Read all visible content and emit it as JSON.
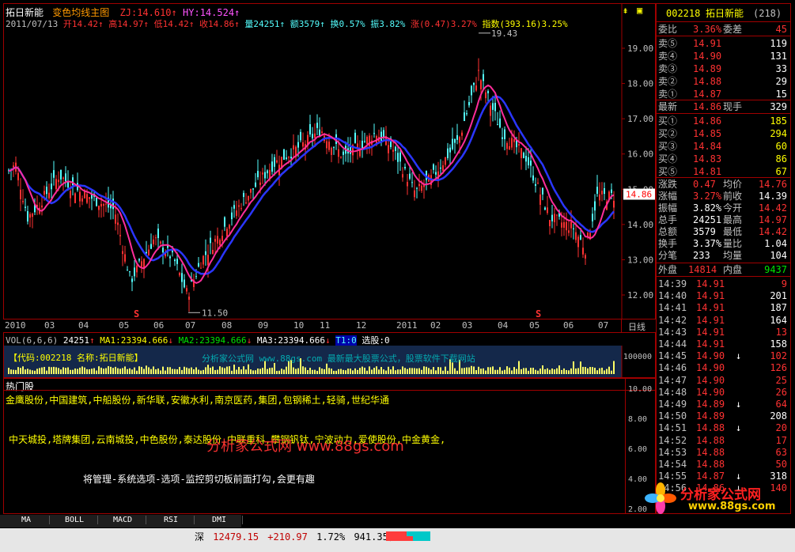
{
  "stock": {
    "code": "002218",
    "name": "拓日新能",
    "count": "(218)"
  },
  "chart_header": {
    "name": "拓日新能",
    "formula": "变色均线主图",
    "zj_label": "ZJ:",
    "zj_value": "14.610",
    "hy_label": "HY:",
    "hy_value": "14.524",
    "date": "2011/07/13",
    "open": "开14.42",
    "high": "高14.97",
    "low": "低14.42",
    "close": "收14.86",
    "vol": "量24251",
    "amt": "额3579",
    "turnover": "换0.57%",
    "amp": "振3.82%",
    "change": "涨(0.47)3.27%",
    "index": "指数(393.16)3.25%"
  },
  "y_axis": [
    "19.00",
    "18.00",
    "17.00",
    "16.00",
    "15.00",
    "14.00",
    "13.00",
    "12.00"
  ],
  "price_tag": "14.86",
  "annotations": {
    "high": "19.43",
    "low": "11.50"
  },
  "signals": [
    "S",
    "S"
  ],
  "x_axis": [
    "2010",
    "03",
    "04",
    "05",
    "06",
    "07",
    "08",
    "09",
    "10",
    "11",
    "12",
    "2011",
    "02",
    "03",
    "04",
    "05",
    "06",
    "07"
  ],
  "x_axis_right": "日线",
  "vol_header": {
    "label": "VOL(6,6,6)",
    "vol": "24251",
    "ma1": "MA1:23394.666",
    "ma2": "MA2:23394.666",
    "ma3": "MA3:23394.666",
    "t1": "T1:0",
    "xg": "选股:0"
  },
  "vol_info": "【代码:002218 名称:拓日新能】",
  "vol_watermark": "分析家公式网 www.88gs.com 最新最大股票公式，股票软件下载网站",
  "vol_axis": "100000",
  "hot": {
    "title": "热门股",
    "line1": "金鹰股份,中国建筑,中船股份,新华联,安徽水利,南京医药,集团,包钢稀土,轻骑,世纪华通",
    "line2": "中天城投,塔牌集团,云南城投,中色股份,泰达股份,中联重科,攀钢钒钛,宁波动力,爱使股份,中金黄金,",
    "watermark": "分析家公式网 www.88gs.com",
    "tip": "将管理-系统选项-选项-监控剪切板前面打勾,会更有趣"
  },
  "hot_axis": [
    "10.00",
    "8.00",
    "6.00",
    "4.00",
    "2.00"
  ],
  "quote": {
    "weibi_label": "委比",
    "weibi_val": "3.36%",
    "weicha_label": "委差",
    "weicha_val": "45",
    "sells": [
      {
        "label": "卖⑤",
        "price": "14.91",
        "vol": "119"
      },
      {
        "label": "卖④",
        "price": "14.90",
        "vol": "131"
      },
      {
        "label": "卖③",
        "price": "14.89",
        "vol": "33"
      },
      {
        "label": "卖②",
        "price": "14.88",
        "vol": "29"
      },
      {
        "label": "卖①",
        "price": "14.87",
        "vol": "15"
      }
    ],
    "last_label": "最新",
    "last": "14.86",
    "xianshou_label": "现手",
    "xianshou": "329",
    "buys": [
      {
        "label": "买①",
        "price": "14.86",
        "vol": "185"
      },
      {
        "label": "买②",
        "price": "14.85",
        "vol": "294"
      },
      {
        "label": "买③",
        "price": "14.84",
        "vol": "60"
      },
      {
        "label": "买④",
        "price": "14.83",
        "vol": "86"
      },
      {
        "label": "买⑤",
        "price": "14.81",
        "vol": "67"
      }
    ],
    "stats": [
      {
        "l1": "涨跌",
        "v1": "0.47",
        "c1": "red",
        "l2": "均价",
        "v2": "14.76",
        "c2": "red"
      },
      {
        "l1": "涨幅",
        "v1": "3.27%",
        "c1": "red",
        "l2": "前收",
        "v2": "14.39",
        "c2": "wht"
      },
      {
        "l1": "振幅",
        "v1": "3.82%",
        "c1": "wht",
        "l2": "今开",
        "v2": "14.42",
        "c2": "red"
      },
      {
        "l1": "总手",
        "v1": "24251",
        "c1": "wht",
        "l2": "最高",
        "v2": "14.97",
        "c2": "red"
      },
      {
        "l1": "总额",
        "v1": "3579",
        "c1": "wht",
        "l2": "最低",
        "v2": "14.42",
        "c2": "red"
      },
      {
        "l1": "换手",
        "v1": "3.37%",
        "c1": "wht",
        "l2": "量比",
        "v2": "1.04",
        "c2": "wht"
      },
      {
        "l1": "分笔",
        "v1": "233",
        "c1": "wht",
        "l2": "均量",
        "v2": "104",
        "c2": "wht"
      }
    ],
    "outer_label": "外盘",
    "outer": "14814",
    "inner_label": "内盘",
    "inner": "9437",
    "ticks": [
      {
        "t": "14:39",
        "p": "14.91",
        "v": "9",
        "d": ""
      },
      {
        "t": "14:40",
        "p": "14.91",
        "v": "201",
        "d": ""
      },
      {
        "t": "14:41",
        "p": "14.91",
        "v": "187",
        "d": ""
      },
      {
        "t": "14:42",
        "p": "14.91",
        "v": "164",
        "d": ""
      },
      {
        "t": "14:43",
        "p": "14.91",
        "v": "13",
        "d": ""
      },
      {
        "t": "14:44",
        "p": "14.91",
        "v": "158",
        "d": ""
      },
      {
        "t": "14:45",
        "p": "14.90",
        "v": "102",
        "d": "↓"
      },
      {
        "t": "14:46",
        "p": "14.90",
        "v": "126",
        "d": ""
      },
      {
        "t": "14:47",
        "p": "14.90",
        "v": "25",
        "d": ""
      },
      {
        "t": "14:48",
        "p": "14.90",
        "v": "26",
        "d": ""
      },
      {
        "t": "14:49",
        "p": "14.89",
        "v": "64",
        "d": "↓"
      },
      {
        "t": "14:50",
        "p": "14.89",
        "v": "208",
        "d": ""
      },
      {
        "t": "14:51",
        "p": "14.88",
        "v": "20",
        "d": "↓"
      },
      {
        "t": "14:52",
        "p": "14.88",
        "v": "17",
        "d": ""
      },
      {
        "t": "14:53",
        "p": "14.88",
        "v": "63",
        "d": ""
      },
      {
        "t": "14:54",
        "p": "14.88",
        "v": "50",
        "d": ""
      },
      {
        "t": "14:55",
        "p": "14.87",
        "v": "318",
        "d": "↓"
      },
      {
        "t": "14:56",
        "p": "14.86",
        "v": "140",
        "d": "↓"
      }
    ]
  },
  "tabs": [
    "MA",
    "BOLL",
    "MACD",
    "RSI",
    "DMI"
  ],
  "status": {
    "market": "深",
    "index": "12479.15",
    "change": "+210.97",
    "pct": "1.72%",
    "amount": "941.35亿"
  },
  "logo": {
    "text": "分析家公式网",
    "url": "www.88gs.com"
  },
  "colors": {
    "up": "#ff3232",
    "down": "#54ffff",
    "ma_fast": "#ff2d9b",
    "ma_slow": "#2a36ff",
    "vol": "#ffff66",
    "accent": "#a00000"
  }
}
